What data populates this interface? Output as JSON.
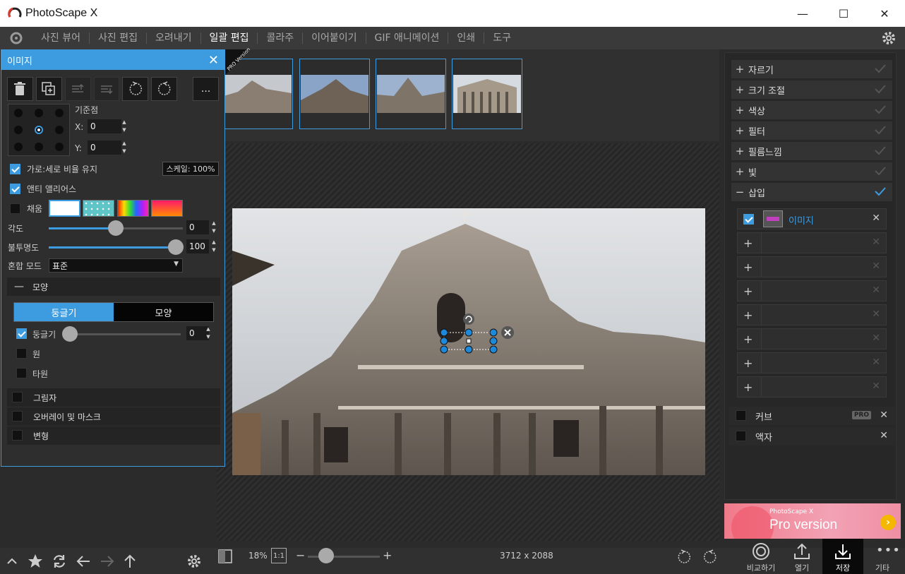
{
  "window": {
    "title": "PhotoScape X",
    "minimize": "—",
    "maximize": "☐",
    "close": "✕"
  },
  "menu": {
    "items": [
      "사진 뷰어",
      "사진 편집",
      "오려내기",
      "일괄 편집",
      "콜라주",
      "이어붙이기",
      "GIF 애니메이션",
      "인쇄",
      "도구"
    ],
    "active_index": 3
  },
  "image_panel": {
    "title": "이미지",
    "more_label": "...",
    "anchor_label": "기준점",
    "x_label": "X:",
    "x_value": "0",
    "y_label": "Y:",
    "y_value": "0",
    "keep_ratio_label": "가로:세로 비율 유지",
    "keep_ratio_checked": true,
    "scale_label": "스케일: 100%",
    "antialias_label": "앤티 앨리어스",
    "antialias_checked": true,
    "fill_label": "채움",
    "fill_checked": false,
    "angle_label": "각도",
    "angle_value": "0",
    "angle_fraction": 0.5,
    "opacity_label": "불투명도",
    "opacity_value": "100",
    "opacity_fraction": 1.0,
    "blend_label": "혼합 모드",
    "blend_value": "표준",
    "shape_section": "모양",
    "shape_tab_round": "둥글기",
    "shape_tab_shape": "모양",
    "round_label": "둥글기",
    "round_value": "0",
    "round_checked": true,
    "circle_label": "원",
    "ellipse_label": "타원",
    "shadow_label": "그림자",
    "overlay_label": "오버레이 및 마스크",
    "transform_label": "변형"
  },
  "thumbnails": {
    "badge_text": "PRO Version"
  },
  "right_panel": {
    "items": [
      "자르기",
      "크기 조절",
      "색상",
      "필터",
      "필름느낌",
      "빛"
    ],
    "insert_label": "삽입",
    "insert_image_label": "이미지",
    "curve_label": "커브",
    "curve_badge": "PRO",
    "frame_label": "액자"
  },
  "ad": {
    "small": "PhotoScape X",
    "big": "Pro version"
  },
  "bottom": {
    "zoom": "18%",
    "one_to_one": "1:1",
    "dimensions": "3712 x 2088",
    "zoom_fraction": 0.25,
    "compare_label": "비교하기",
    "open_label": "열기",
    "save_label": "저장",
    "more_label": "기타"
  },
  "colors": {
    "accent": "#3d9ce0",
    "panel": "#2e2e2e",
    "menu_bg": "#3a3a3a"
  }
}
